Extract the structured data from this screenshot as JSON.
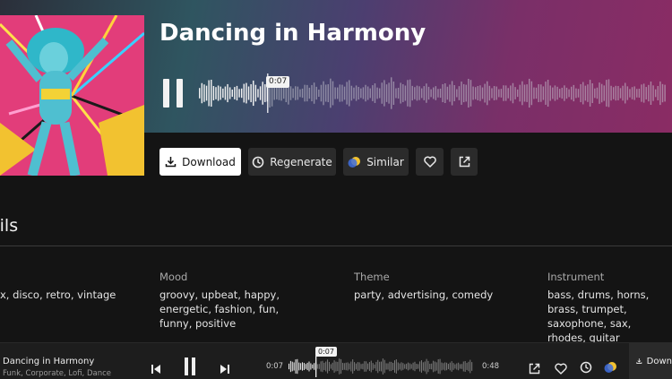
{
  "track": {
    "title": "Dancing in Harmony",
    "current_time": "0:07",
    "duration": "0:48",
    "progress": 0.146
  },
  "actions": {
    "download": "Download",
    "regenerate": "Regenerate",
    "similar": "Similar"
  },
  "details": {
    "heading": "ails",
    "columns": [
      {
        "label": "",
        "value": "x, disco, retro, vintage"
      },
      {
        "label": "Mood",
        "value": "groovy, upbeat, happy, energetic, fashion, fun, funny, positive"
      },
      {
        "label": "Theme",
        "value": "party, advertising, comedy"
      },
      {
        "label": "Instrument",
        "value": "bass, drums, horns, brass, trumpet, saxophone, sax, rhodes, guitar"
      }
    ]
  },
  "player": {
    "title": "Dancing in Harmony",
    "tags": "Funk, Corporate, Lofi, Dance",
    "current_time": "0:07",
    "duration": "0:48",
    "download_label": "Down"
  },
  "colors": {
    "background": "#141414",
    "accent_white": "#ffffff",
    "button_bg": "#2b2b2b"
  }
}
